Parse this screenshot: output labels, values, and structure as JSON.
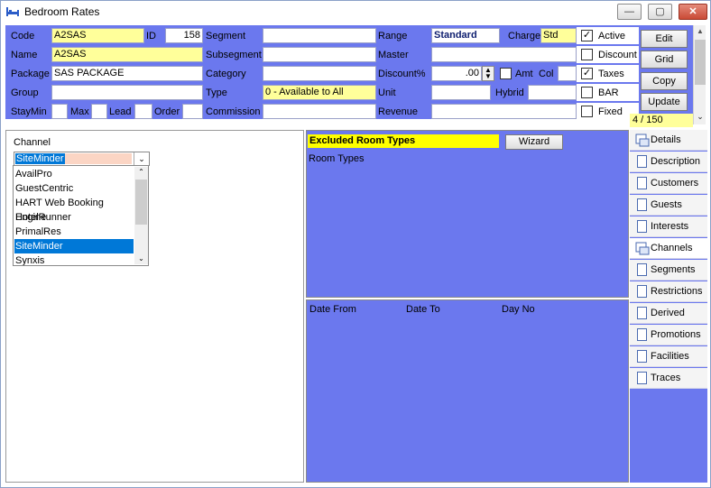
{
  "window": {
    "title": "Bedroom Rates"
  },
  "titlebar": {
    "minimize": "—",
    "maximize": "▢",
    "close": "✕"
  },
  "form": {
    "code_label": "Code",
    "code_value": "A2SAS",
    "id_label": "ID",
    "id_value": "158",
    "name_label": "Name",
    "name_value": "A2SAS",
    "package_label": "Package",
    "package_value": "SAS PACKAGE",
    "group_label": "Group",
    "group_value": "",
    "staymin_label": "StayMin",
    "max_label": "Max",
    "lead_label": "Lead",
    "order_label": "Order",
    "segment_label": "Segment",
    "segment_value": "",
    "subsegment_label": "Subsegment",
    "subsegment_value": "",
    "category_label": "Category",
    "category_value": "",
    "type_label": "Type",
    "type_value": "0 - Available to All",
    "commission_label": "Commission",
    "commission_value": "",
    "range_label": "Range",
    "range_value": "Standard",
    "charge_label": "Charge",
    "charge_value": "Std",
    "master_label": "Master",
    "master_value": "",
    "discount_label": "Discount%",
    "discount_value": ".00",
    "amt_label": "Amt",
    "col_label": "Col",
    "col_value": "",
    "unit_label": "Unit",
    "unit_value": "",
    "hybrid_label": "Hybrid",
    "hybrid_value": "",
    "revenue_label": "Revenue",
    "revenue_value": ""
  },
  "checks": {
    "active_label": "Active",
    "active": "✓",
    "discount_label": "Discount",
    "discount": "",
    "taxes_label": "Taxes",
    "taxes": "✓",
    "bar_label": "BAR",
    "bar": "",
    "fixed_label": "Fixed",
    "fixed": ""
  },
  "actions": {
    "edit": "Edit",
    "grid": "Grid",
    "copy": "Copy",
    "update": "Update"
  },
  "record_counter": "4 / 150",
  "channel": {
    "label": "Channel",
    "selected": "SiteMinder",
    "options": [
      "AvailPro",
      "GuestCentric",
      "HART Web Booking Engine",
      "HotelRunner",
      "PrimalRes",
      "SiteMinder",
      "Synxis"
    ]
  },
  "excluded": {
    "title": "Excluded Room Types",
    "wizard": "Wizard",
    "room_types_header": "Room Types"
  },
  "dates": {
    "date_from": "Date From",
    "date_to": "Date To",
    "day_no": "Day No"
  },
  "tabs": [
    "Details",
    "Description",
    "Customers",
    "Guests",
    "Interests",
    "Channels",
    "Segments",
    "Restrictions",
    "Derived",
    "Promotions",
    "Facilities",
    "Traces"
  ],
  "active_tab": "Channels"
}
